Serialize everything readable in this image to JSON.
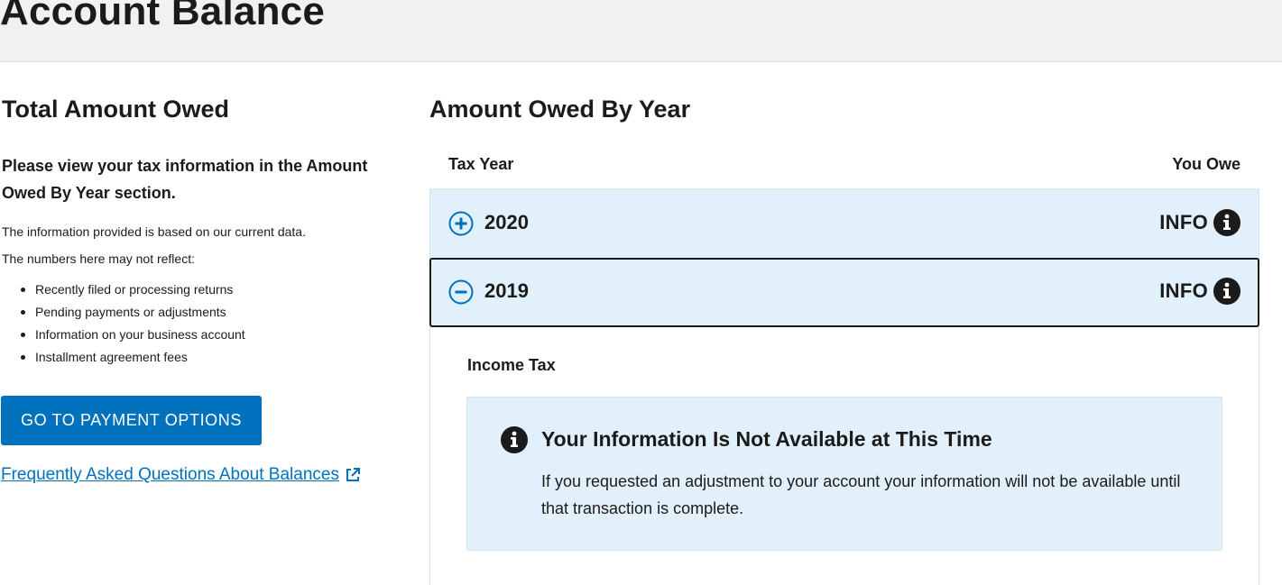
{
  "header": {
    "title": "Account Balance"
  },
  "left": {
    "heading": "Total Amount Owed",
    "lead": "Please view your tax information in the Amount Owed By Year section.",
    "note_1": "The information provided is based on our current data.",
    "note_2": "The numbers here may not reflect:",
    "bullets": [
      "Recently filed or processing returns",
      "Pending payments or adjustments",
      "Information on your business account",
      "Installment agreement fees"
    ],
    "payment_button": "GO TO PAYMENT OPTIONS",
    "faq_link": "Frequently Asked Questions About Balances"
  },
  "right": {
    "heading": "Amount Owed By Year",
    "columns": {
      "year": "Tax Year",
      "owe": "You Owe"
    },
    "rows": [
      {
        "year": "2020",
        "status": "INFO",
        "expanded": false,
        "toggle_icon": "plus-circle-icon"
      },
      {
        "year": "2019",
        "status": "INFO",
        "expanded": true,
        "toggle_icon": "minus-circle-icon"
      }
    ],
    "detail": {
      "label": "Income Tax",
      "alert_title": "Your Information Is Not Available at This Time",
      "alert_body": "If you requested an adjustment to your account your information will not be available until that transaction is complete."
    }
  },
  "colors": {
    "primary": "#0071bc",
    "row_bg": "#e1f0fa",
    "header_bg": "#f1f1f1",
    "text": "#1b1b1b"
  }
}
